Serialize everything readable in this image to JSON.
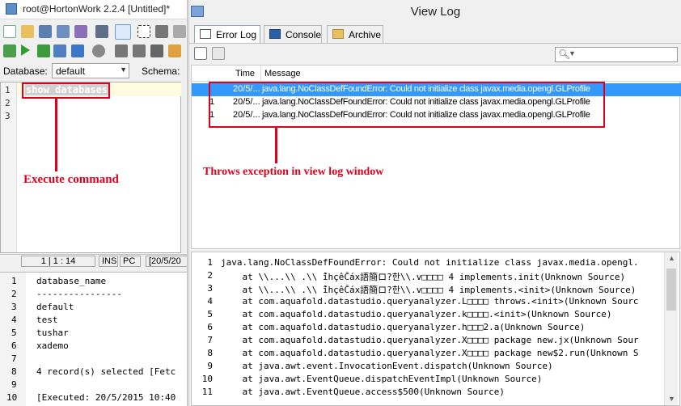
{
  "left_window": {
    "title": "root@HortonWork 2.2.4 [Untitled]*",
    "database_label": "Database:",
    "database_value": "default",
    "schema_label": "Schema:",
    "editor_lines": [
      "1",
      "2",
      "3"
    ],
    "editor_code": "show databases",
    "annotation": "Execute command",
    "status": {
      "pos": "1 | 1 : 14",
      "ins": "INS",
      "pc": "PC",
      "date": "[20/5/20"
    },
    "results": [
      {
        "n": "1",
        "text": "database_name"
      },
      {
        "n": "2",
        "text": "----------------"
      },
      {
        "n": "3",
        "text": "default"
      },
      {
        "n": "4",
        "text": "test"
      },
      {
        "n": "5",
        "text": "tushar"
      },
      {
        "n": "6",
        "text": "xademo"
      },
      {
        "n": "7",
        "text": ""
      },
      {
        "n": "8",
        "text": "4 record(s) selected [Fetc"
      },
      {
        "n": "9",
        "text": ""
      },
      {
        "n": "10",
        "text": "[Executed: 20/5/2015 10:40"
      }
    ]
  },
  "right_window": {
    "title": "View Log",
    "tabs": [
      {
        "label": "Error Log",
        "icon": "error-log-icon"
      },
      {
        "label": "Console",
        "icon": "console-icon"
      },
      {
        "label": "Archive",
        "icon": "folder-icon"
      }
    ],
    "columns": [
      "Time",
      "Message"
    ],
    "rows": [
      {
        "mark": "",
        "time": "20/5/...",
        "message": "java.lang.NoClassDefFoundError: Could not initialize class javax.media.opengl.GLProfile",
        "selected": true
      },
      {
        "mark": "1",
        "time": "20/5/...",
        "message": "java.lang.NoClassDefFoundError: Could not initialize class javax.media.opengl.GLProfile",
        "selected": false
      },
      {
        "mark": "1",
        "time": "20/5/...",
        "message": "java.lang.NoClassDefFoundError: Could not initialize class javax.media.opengl.GLProfile",
        "selected": false
      }
    ],
    "annotation": "Throws exception in view log window",
    "stack_trace": [
      {
        "n": "1",
        "text": "java.lang.NoClassDefFoundError: Could not initialize class javax.media.opengl."
      },
      {
        "n": "2",
        "text": "    at \\\\...\\\\ .\\\\ ỉ̃hçêČáx語簡ロ?한\\\\.v□□□□ 4 implements.init(Unknown Source)"
      },
      {
        "n": "3",
        "text": "    at \\\\...\\\\ .\\\\ ỉ̃hçêČáx語簡ロ?한\\\\.v□□□□ 4 implements.<init>(Unknown Source)"
      },
      {
        "n": "4",
        "text": "    at com.aquafold.datastudio.queryanalyzer.L□□□□ throws.<init>(Unknown Sourc"
      },
      {
        "n": "5",
        "text": "    at com.aquafold.datastudio.queryanalyzer.k□□□□.<init>(Unknown Source)"
      },
      {
        "n": "6",
        "text": "    at com.aquafold.datastudio.queryanalyzer.h□□□2.a(Unknown Source)"
      },
      {
        "n": "7",
        "text": "    at com.aquafold.datastudio.queryanalyzer.X□□□□ package new.jx(Unknown Sour"
      },
      {
        "n": "8",
        "text": "    at com.aquafold.datastudio.queryanalyzer.X□□□□ package new$2.run(Unknown S"
      },
      {
        "n": "9",
        "text": "    at java.awt.event.InvocationEvent.dispatch(Unknown Source)"
      },
      {
        "n": "10",
        "text": "    at java.awt.EventQueue.dispatchEventImpl(Unknown Source)"
      },
      {
        "n": "11",
        "text": "    at java.awt.EventQueue.access$500(Unknown Source)"
      }
    ]
  },
  "colors": {
    "annotation_red": "#e0001b",
    "selection_blue": "#3399ff"
  }
}
